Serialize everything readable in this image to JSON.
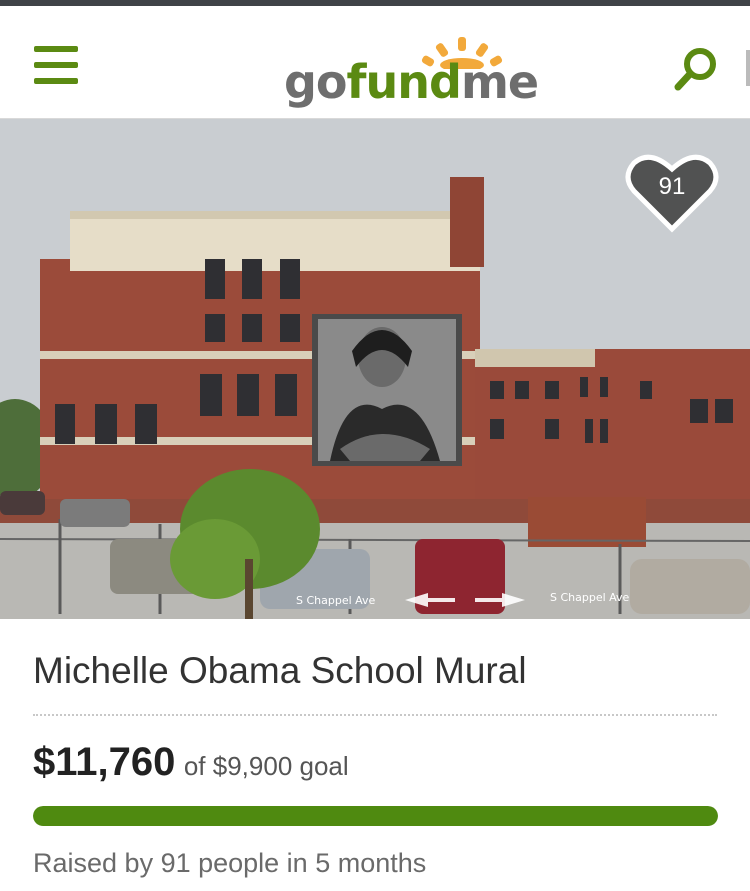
{
  "header": {
    "logo": {
      "go": "go",
      "fund": "fund",
      "me": "me"
    },
    "menu_icon": "hamburger-icon",
    "search_icon": "search-icon"
  },
  "hero": {
    "street_labels": [
      "S Chappel Ave",
      "S Chappel Ave"
    ],
    "hearts": "91"
  },
  "campaign": {
    "title": "Michelle Obama School Mural",
    "amount_raised": "$11,760",
    "goal_text": "of $9,900 goal",
    "progress_fraction": 1.0,
    "raised_by": "Raised by 91 people in 5 months"
  },
  "colors": {
    "brand_green": "#5b8a12",
    "progress_green": "#4f8a10",
    "logo_orange": "#f2a93b"
  }
}
